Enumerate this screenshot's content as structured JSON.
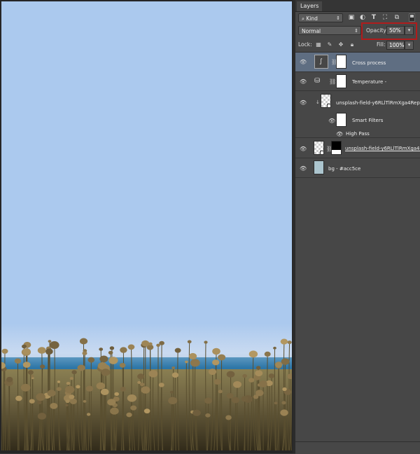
{
  "panel": {
    "title": "Layers",
    "menu_icon": "panel-menu-icon"
  },
  "filter": {
    "kind_label": "Kind",
    "kind_icon": "search-icon",
    "icons": [
      "pixel-filter-icon",
      "adjustment-filter-icon",
      "type-filter-icon",
      "shape-filter-icon",
      "smart-object-filter-icon"
    ]
  },
  "blend": {
    "mode": "Normal",
    "opacity_label": "Opacity:",
    "opacity_value": "50%"
  },
  "lock": {
    "label": "Lock:",
    "fill_label": "Fill:",
    "fill_value": "100%"
  },
  "layers": [
    {
      "name": "Cross process",
      "type": "adjustment",
      "selected": true
    },
    {
      "name": "Temperature -",
      "type": "adjustment",
      "selected": false
    },
    {
      "name": "unsplash-field-y6RLlTlRmXga4RephkN",
      "type": "smart-object",
      "selected": false
    },
    {
      "name": "Smart Filters",
      "type": "smart-filters",
      "selected": false
    },
    {
      "name": "High Pass",
      "type": "filter",
      "selected": false
    },
    {
      "name": "unsplash-field-y6RLlTlRmXga4RephkN",
      "type": "smart-object-masked",
      "selected": false
    },
    {
      "name": "bg - #acc5ce",
      "type": "fill",
      "selected": false
    }
  ],
  "colors": {
    "highlight_box": "#b01c1c",
    "selected_row": "#5f6e82",
    "bg_swatch": "#acc5ce",
    "canvas_sky": "#abc9ee"
  }
}
